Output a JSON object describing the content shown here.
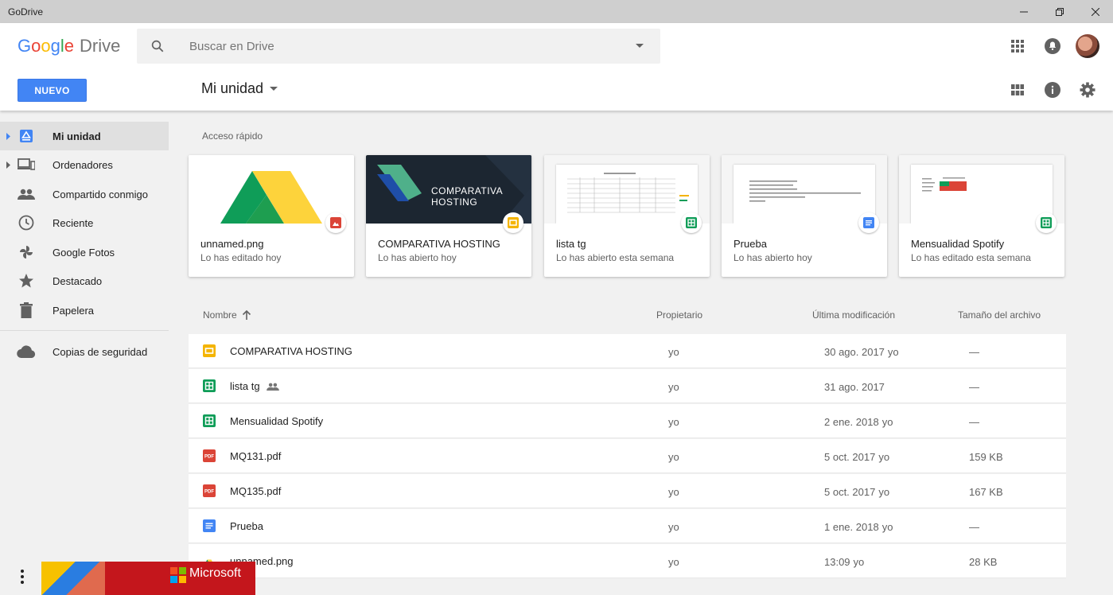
{
  "window": {
    "title": "GoDrive"
  },
  "logo": {
    "google": "Google",
    "product": "Drive"
  },
  "search": {
    "placeholder": "Buscar en Drive"
  },
  "toolbar": {
    "new_label": "NUEVO",
    "breadcrumb": "Mi unidad"
  },
  "sidebar": {
    "items": [
      {
        "label": "Mi unidad",
        "icon": "my-drive-icon",
        "active": true
      },
      {
        "label": "Ordenadores",
        "icon": "computers-icon"
      },
      {
        "label": "Compartido conmigo",
        "icon": "shared-people-icon"
      },
      {
        "label": "Reciente",
        "icon": "clock-icon"
      },
      {
        "label": "Google Fotos",
        "icon": "photos-pinwheel-icon"
      },
      {
        "label": "Destacado",
        "icon": "star-icon"
      },
      {
        "label": "Papelera",
        "icon": "trash-icon"
      },
      {
        "label": "Copias de seguridad",
        "icon": "cloud-icon"
      }
    ]
  },
  "quick_access": {
    "label": "Acceso rápido",
    "cards": [
      {
        "name": "unnamed.png",
        "subtitle": "Lo has editado hoy",
        "type": "image"
      },
      {
        "name": "COMPARATIVA HOSTING",
        "subtitle": "Lo has abierto hoy",
        "type": "slides",
        "thumb_text": "COMPARATIVA\nHOSTING"
      },
      {
        "name": "lista tg",
        "subtitle": "Lo has abierto esta semana",
        "type": "sheets"
      },
      {
        "name": "Prueba",
        "subtitle": "Lo has abierto hoy",
        "type": "docs"
      },
      {
        "name": "Mensualidad Spotify",
        "subtitle": "Lo has editado esta semana",
        "type": "sheets"
      }
    ]
  },
  "file_list": {
    "headers": {
      "name": "Nombre",
      "owner": "Propietario",
      "modified": "Última modificación",
      "size": "Tamaño del archivo"
    },
    "rows": [
      {
        "name": "COMPARATIVA HOSTING",
        "type": "slides",
        "owner": "yo",
        "modified": "30 ago. 2017",
        "modified_by": "yo",
        "size": "—"
      },
      {
        "name": "lista tg",
        "type": "sheets",
        "shared": true,
        "owner": "yo",
        "modified": "31 ago. 2017",
        "modified_by": "",
        "size": "—"
      },
      {
        "name": "Mensualidad Spotify",
        "type": "sheets",
        "owner": "yo",
        "modified": "2 ene. 2018",
        "modified_by": "yo",
        "size": "—"
      },
      {
        "name": "MQ131.pdf",
        "type": "pdf",
        "owner": "yo",
        "modified": "5 oct. 2017",
        "modified_by": "yo",
        "size": "159 KB"
      },
      {
        "name": "MQ135.pdf",
        "type": "pdf",
        "owner": "yo",
        "modified": "5 oct. 2017",
        "modified_by": "yo",
        "size": "167 KB"
      },
      {
        "name": "Prueba",
        "type": "docs",
        "owner": "yo",
        "modified": "1 ene. 2018",
        "modified_by": "yo",
        "size": "—"
      },
      {
        "name": "unnamed.png",
        "type": "drive-image",
        "owner": "yo",
        "modified": "13:09",
        "modified_by": "yo",
        "size": "28 KB"
      }
    ]
  },
  "ad": {
    "brand": "Microsoft"
  },
  "colors": {
    "accent": "#4285f4",
    "slides": "#f4b400",
    "sheets": "#0f9d58",
    "docs": "#4285f4",
    "pdf": "#db4437",
    "ad": "#c4161c"
  }
}
